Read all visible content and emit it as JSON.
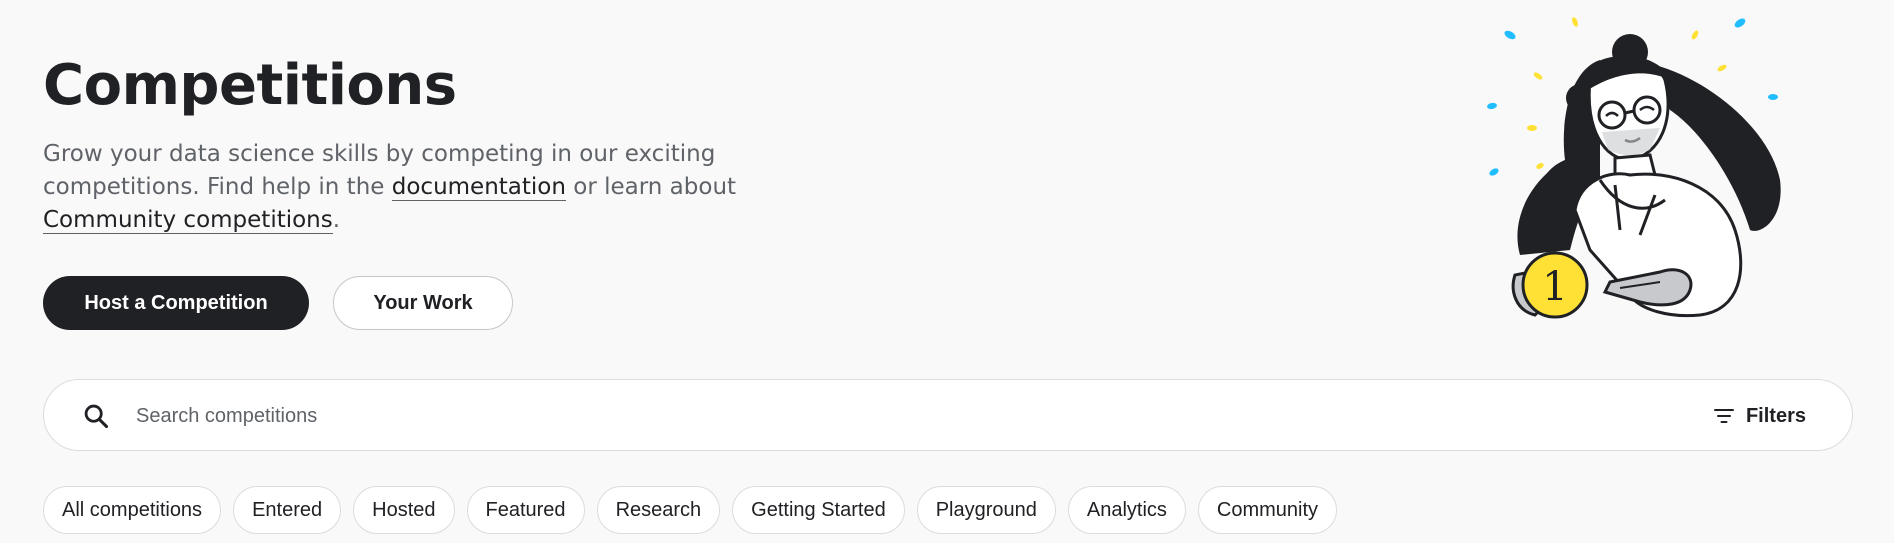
{
  "hero": {
    "title": "Competitions",
    "description_part1": "Grow your data science skills by competing in our exciting competitions. Find help in the ",
    "documentation_link": "documentation",
    "description_part2": " or learn about ",
    "community_link": "Community competitions",
    "description_part3": "."
  },
  "actions": {
    "host_label": "Host a Competition",
    "your_work_label": "Your Work"
  },
  "search": {
    "placeholder": "Search competitions",
    "icon": "search-icon",
    "filters_label": "Filters",
    "filters_icon": "filter-icon"
  },
  "chips": [
    "All competitions",
    "Entered",
    "Hosted",
    "Featured",
    "Research",
    "Getting Started",
    "Playground",
    "Analytics",
    "Community"
  ],
  "colors": {
    "primary_button": "#202124",
    "background": "#f9f9f9",
    "confetti_blue": "#20beff",
    "confetti_yellow": "#ffe135",
    "coin_yellow": "#ffe135"
  },
  "illustration": {
    "coin_text": "1"
  }
}
